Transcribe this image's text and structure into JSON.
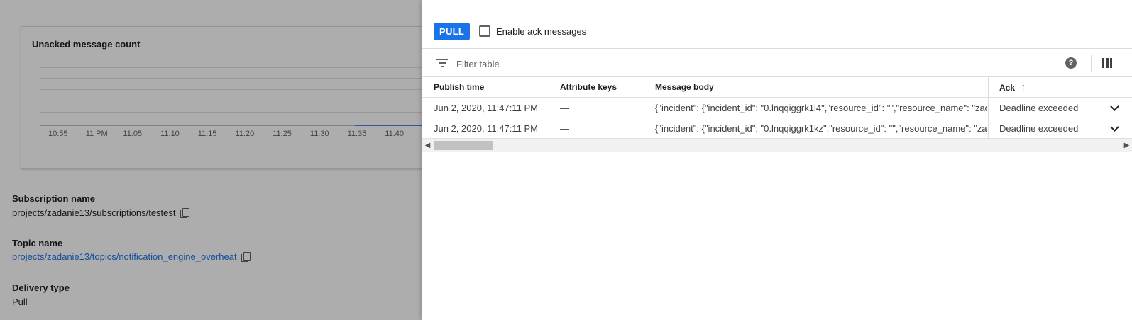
{
  "background": {
    "chart_card": {
      "title": "Unacked message count",
      "chart_data": {
        "type": "line",
        "title": "Unacked message count",
        "x": [
          "10:55",
          "11 PM",
          "11:05",
          "11:10",
          "11:15",
          "11:20",
          "11:25",
          "11:30",
          "11:35",
          "11:40"
        ],
        "series": [
          {
            "values": [
              null,
              null,
              null,
              null,
              null,
              null,
              null,
              null,
              0,
              0
            ]
          }
        ],
        "grid": true,
        "series_color": "#4285f4"
      }
    },
    "fields": [
      {
        "label": "Subscription name",
        "value": "projects/zadanie13/subscriptions/testest",
        "icon": "copy-icon"
      },
      {
        "label": "Topic name",
        "value": "projects/zadanie13/topics/notification_engine_overheat",
        "icon": "copy-icon"
      },
      {
        "label": "Delivery type",
        "value": "Pull"
      }
    ]
  },
  "panel": {
    "pull_label": "PULL",
    "ack_checkbox_label": "Enable ack messages",
    "ack_checkbox_checked": false,
    "filter_placeholder": "Filter table",
    "icons": {
      "filter": "filter-icon",
      "help": "help-icon",
      "columns": "column-display-icon"
    },
    "columns": {
      "publish_time": "Publish time",
      "attribute_keys": "Attribute keys",
      "message_body": "Message body",
      "ack": "Ack"
    },
    "sort": {
      "column": "Ack",
      "direction": "ascending"
    },
    "rows": [
      {
        "publish_time": "Jun 2, 2020, 11:47:11 PM",
        "attribute_keys": "—",
        "message_body": "{\"incident\": {\"incident_id\": \"0.lnqqiggrk1l4\",\"resource_id\": \"\",\"resource_name\": \"zadani",
        "ack": "Deadline exceeded"
      },
      {
        "publish_time": "Jun 2, 2020, 11:47:11 PM",
        "attribute_keys": "—",
        "message_body": "{\"incident\": {\"incident_id\": \"0.lnqqiggrk1kz\",\"resource_id\": \"\",\"resource_name\": \"zadan",
        "ack": "Deadline exceeded"
      }
    ],
    "accent_color": "#1a73e8"
  }
}
